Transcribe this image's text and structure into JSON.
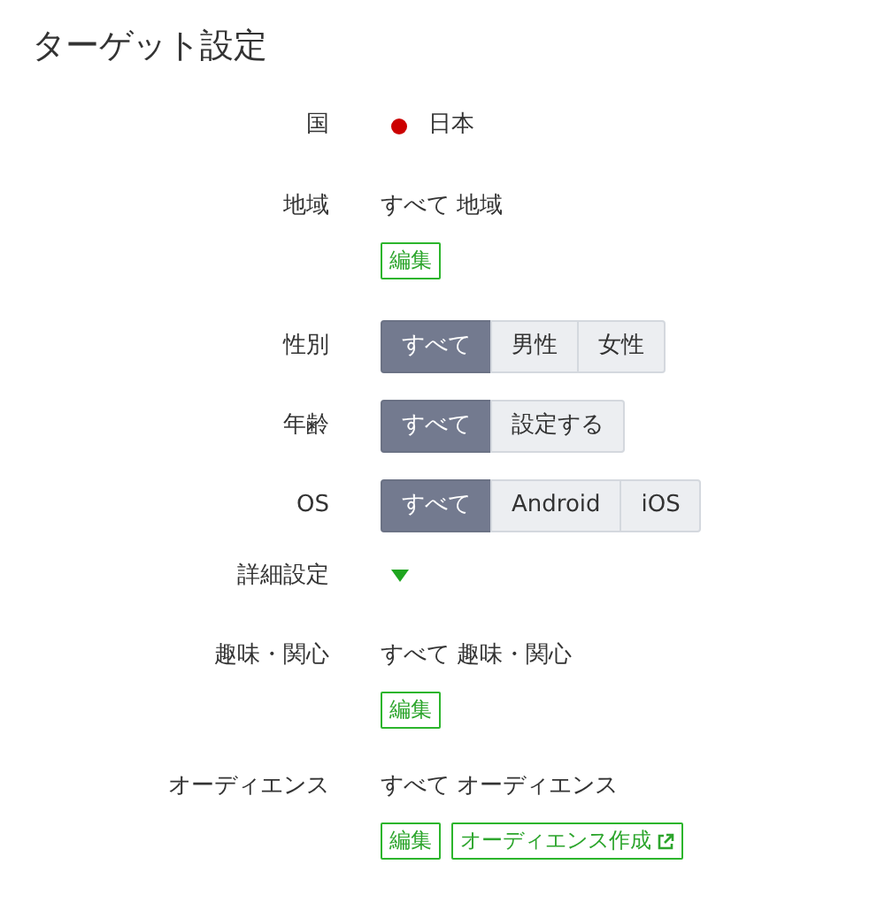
{
  "title": "ターゲット設定",
  "rows": [
    {
      "kind": "country",
      "label": "国",
      "value": "日本",
      "color": "#cc0000"
    },
    {
      "kind": "summary",
      "label": "地域",
      "value": "すべて 地域",
      "buttons": [
        {
          "label": "編集",
          "external": false
        }
      ]
    },
    {
      "kind": "segmented",
      "label": "性別",
      "options": [
        {
          "label": "すべて",
          "selected": true
        },
        {
          "label": "男性",
          "selected": false
        },
        {
          "label": "女性",
          "selected": false
        }
      ]
    },
    {
      "kind": "segmented",
      "label": "年齢",
      "options": [
        {
          "label": "すべて",
          "selected": true
        },
        {
          "label": "設定する",
          "selected": false
        }
      ]
    },
    {
      "kind": "segmented",
      "label": "OS",
      "options": [
        {
          "label": "すべて",
          "selected": true
        },
        {
          "label": "Android",
          "selected": false
        },
        {
          "label": "iOS",
          "selected": false
        }
      ]
    },
    {
      "kind": "disclosure",
      "label": "詳細設定",
      "expanded": false
    },
    {
      "kind": "summary",
      "label": "趣味・関心",
      "value": "すべて 趣味・関心",
      "buttons": [
        {
          "label": "編集",
          "external": false
        }
      ]
    },
    {
      "kind": "summary",
      "label": "オーディエンス",
      "value": "すべて オーディエンス",
      "buttons": [
        {
          "label": "編集",
          "external": false
        },
        {
          "label": "オーディエンス作成",
          "external": true
        }
      ]
    }
  ]
}
